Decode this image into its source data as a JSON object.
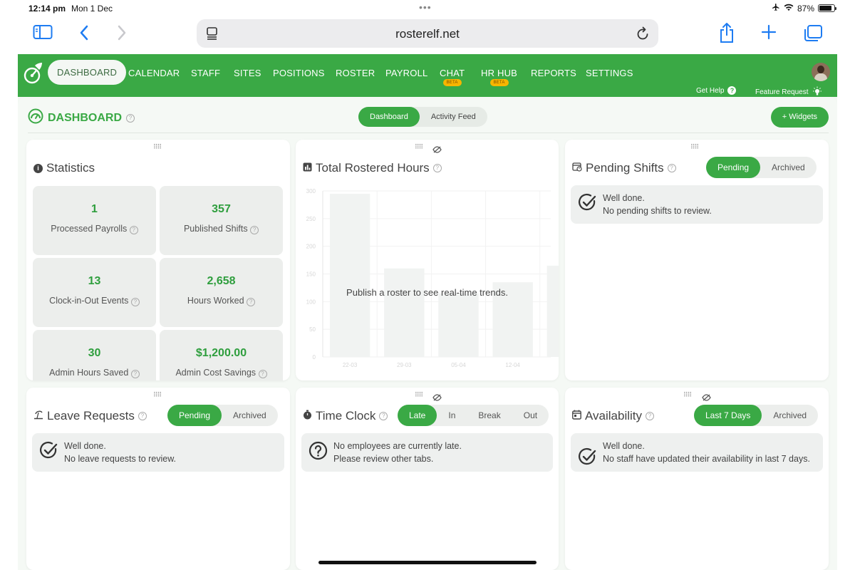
{
  "status_bar": {
    "time": "12:14 pm",
    "date": "Mon 1 Dec",
    "battery": "87%"
  },
  "browser": {
    "url": "rosterelf.net"
  },
  "nav": {
    "items": [
      "DASHBOARD",
      "CALENDAR",
      "STAFF",
      "SITES",
      "POSITIONS",
      "ROSTER",
      "PAYROLL",
      "CHAT",
      "HR HUB",
      "REPORTS",
      "SETTINGS"
    ],
    "beta": "BETA",
    "get_help": "Get Help",
    "feature_request": "Feature Request"
  },
  "page": {
    "title": "DASHBOARD",
    "toggle": [
      "Dashboard",
      "Activity Feed"
    ],
    "widgets_button": "+ Widgets"
  },
  "statistics": {
    "title": "Statistics",
    "cards": [
      {
        "value": "1",
        "label": "Processed Payrolls"
      },
      {
        "value": "357",
        "label": "Published Shifts"
      },
      {
        "value": "13",
        "label": "Clock-in-Out Events"
      },
      {
        "value": "2,658",
        "label": "Hours Worked"
      },
      {
        "value": "30",
        "label": "Admin Hours Saved"
      },
      {
        "value": "$1,200.00",
        "label": "Admin Cost Savings"
      }
    ]
  },
  "rostered": {
    "title": "Total Rostered Hours",
    "message": "Publish a roster to see real-time trends."
  },
  "chart_data": {
    "type": "bar",
    "categories": [
      "22-03",
      "29-03",
      "05-04",
      "12-04"
    ],
    "values": [
      295,
      160,
      115,
      135
    ],
    "partial_next_value": 165,
    "title": "Total Rostered Hours",
    "xlabel": "",
    "ylabel": "",
    "ylim": [
      0,
      300
    ],
    "yticks": [
      0,
      50,
      100,
      150,
      200,
      250,
      300
    ],
    "grid": true,
    "bar_color": "#f1f3f2",
    "faded": true
  },
  "pending_shifts": {
    "title": "Pending Shifts",
    "tabs": [
      "Pending",
      "Archived"
    ],
    "msg1": "Well done.",
    "msg2": "No pending shifts to review."
  },
  "leave": {
    "title": "Leave Requests",
    "tabs": [
      "Pending",
      "Archived"
    ],
    "msg1": "Well done.",
    "msg2": "No leave requests to review."
  },
  "timeclock": {
    "title": "Time Clock",
    "tabs": [
      "Late",
      "In",
      "Break",
      "Out"
    ],
    "msg1": "No employees are currently late.",
    "msg2": "Please review other tabs."
  },
  "availability": {
    "title": "Availability",
    "tabs": [
      "Last 7 Days",
      "Archived"
    ],
    "msg1": "Well done.",
    "msg2": "No staff have updated their availability in last 7 days."
  },
  "colors": {
    "brand_green": "#3aa945",
    "ios_blue": "#1e7cf2",
    "beta_badge": "#f7b500"
  }
}
